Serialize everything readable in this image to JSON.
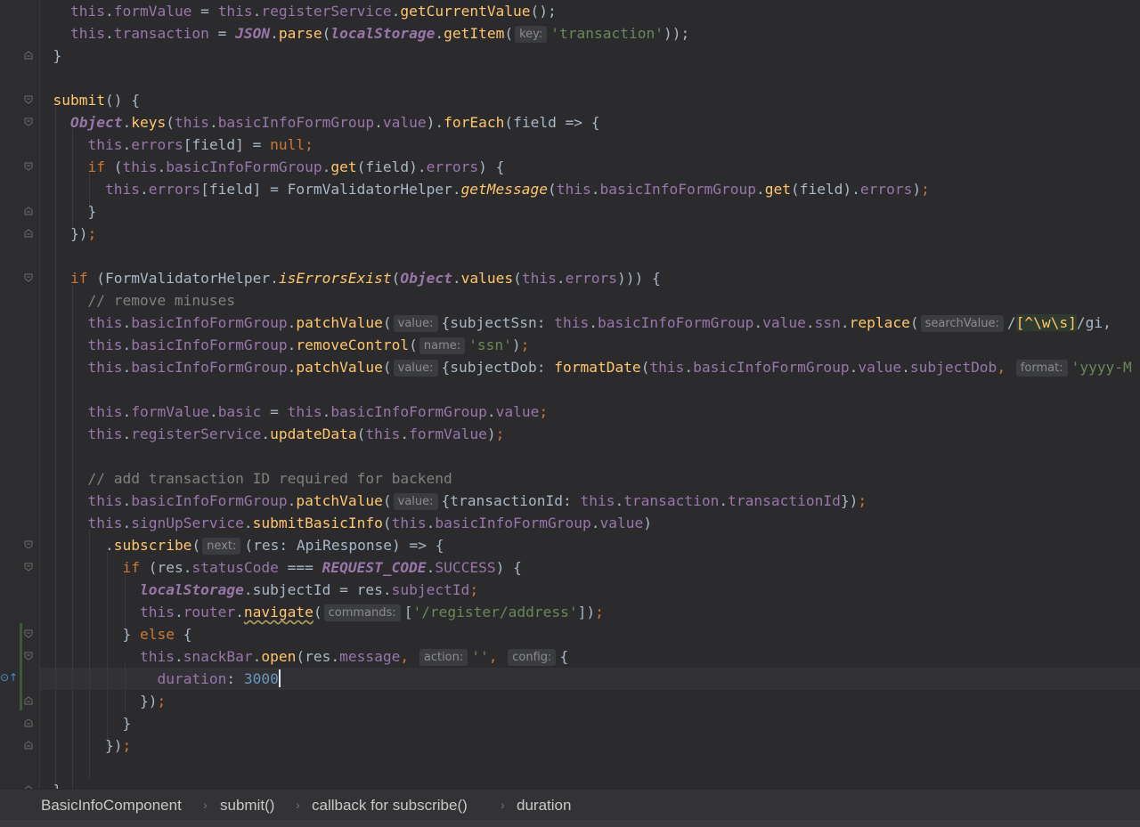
{
  "code_lines": [
    [
      [
        "p",
        "    "
      ],
      [
        "t",
        "this"
      ],
      [
        "p",
        "."
      ],
      [
        "t",
        "formValue"
      ],
      [
        "p",
        " = "
      ],
      [
        "t",
        "this"
      ],
      [
        "p",
        "."
      ],
      [
        "t",
        "registerService"
      ],
      [
        "p",
        "."
      ],
      [
        "f",
        "getCurrentValue"
      ],
      [
        "p",
        "();"
      ]
    ],
    [
      [
        "p",
        "    "
      ],
      [
        "t",
        "this"
      ],
      [
        "p",
        "."
      ],
      [
        "t",
        "transaction"
      ],
      [
        "p",
        " = "
      ],
      [
        "g",
        "JSON"
      ],
      [
        "p",
        "."
      ],
      [
        "f",
        "parse"
      ],
      [
        "p",
        "("
      ],
      [
        "g",
        "localStorage"
      ],
      [
        "p",
        "."
      ],
      [
        "f",
        "getItem"
      ],
      [
        "p",
        "("
      ],
      [
        "hint",
        "key:"
      ],
      [
        "s",
        "'transaction'"
      ],
      [
        "p",
        "));"
      ]
    ],
    [
      [
        "p",
        "  }"
      ]
    ],
    [
      [
        "p",
        ""
      ]
    ],
    [
      [
        "p",
        "  "
      ],
      [
        "f",
        "submit"
      ],
      [
        "p",
        "() {"
      ]
    ],
    [
      [
        "p",
        "    "
      ],
      [
        "g",
        "Object"
      ],
      [
        "p",
        "."
      ],
      [
        "f",
        "keys"
      ],
      [
        "p",
        "("
      ],
      [
        "t",
        "this"
      ],
      [
        "p",
        "."
      ],
      [
        "t",
        "basicInfoFormGroup"
      ],
      [
        "p",
        "."
      ],
      [
        "t",
        "value"
      ],
      [
        "p",
        ")."
      ],
      [
        "f",
        "forEach"
      ],
      [
        "p",
        "(field => {"
      ]
    ],
    [
      [
        "p",
        "      "
      ],
      [
        "t",
        "this"
      ],
      [
        "p",
        "."
      ],
      [
        "t",
        "errors"
      ],
      [
        "p",
        "[field] = "
      ],
      [
        "k",
        "null"
      ],
      [
        "k",
        ";"
      ]
    ],
    [
      [
        "p",
        "      "
      ],
      [
        "k",
        "if "
      ],
      [
        "p",
        "("
      ],
      [
        "t",
        "this"
      ],
      [
        "p",
        "."
      ],
      [
        "t",
        "basicInfoFormGroup"
      ],
      [
        "p",
        "."
      ],
      [
        "f",
        "get"
      ],
      [
        "p",
        "(field)."
      ],
      [
        "t",
        "errors"
      ],
      [
        "p",
        ") {"
      ]
    ],
    [
      [
        "p",
        "        "
      ],
      [
        "t",
        "this"
      ],
      [
        "p",
        "."
      ],
      [
        "t",
        "errors"
      ],
      [
        "p",
        "[field] = FormValidatorHelper."
      ],
      [
        "gi",
        "getMessage"
      ],
      [
        "p",
        "("
      ],
      [
        "t",
        "this"
      ],
      [
        "p",
        "."
      ],
      [
        "t",
        "basicInfoFormGroup"
      ],
      [
        "p",
        "."
      ],
      [
        "f",
        "get"
      ],
      [
        "p",
        "(field)."
      ],
      [
        "t",
        "errors"
      ],
      [
        "p",
        ")"
      ],
      [
        "k",
        ";"
      ]
    ],
    [
      [
        "p",
        "      }"
      ]
    ],
    [
      [
        "p",
        "    })"
      ],
      [
        "k",
        ";"
      ]
    ],
    [
      [
        "p",
        ""
      ]
    ],
    [
      [
        "p",
        "    "
      ],
      [
        "k",
        "if "
      ],
      [
        "p",
        "(FormValidatorHelper."
      ],
      [
        "gi",
        "isErrorsExist"
      ],
      [
        "p",
        "("
      ],
      [
        "g",
        "Object"
      ],
      [
        "p",
        "."
      ],
      [
        "f",
        "values"
      ],
      [
        "p",
        "("
      ],
      [
        "t",
        "this"
      ],
      [
        "p",
        "."
      ],
      [
        "t",
        "errors"
      ],
      [
        "p",
        "))) {"
      ]
    ],
    [
      [
        "c",
        "      // remove minuses"
      ]
    ],
    [
      [
        "p",
        "      "
      ],
      [
        "t",
        "this"
      ],
      [
        "p",
        "."
      ],
      [
        "t",
        "basicInfoFormGroup"
      ],
      [
        "p",
        "."
      ],
      [
        "f",
        "patchValue"
      ],
      [
        "p",
        "("
      ],
      [
        "hint",
        "value:"
      ],
      [
        "p",
        "{subjectSsn: "
      ],
      [
        "t",
        "this"
      ],
      [
        "p",
        "."
      ],
      [
        "t",
        "basicInfoFormGroup"
      ],
      [
        "p",
        "."
      ],
      [
        "t",
        "value"
      ],
      [
        "p",
        "."
      ],
      [
        "t",
        "ssn"
      ],
      [
        "p",
        "."
      ],
      [
        "f",
        "replace"
      ],
      [
        "p",
        "("
      ],
      [
        "hint",
        "searchValue:"
      ],
      [
        "p",
        "/"
      ],
      [
        "rx",
        "[^\\w\\s]"
      ],
      [
        "p",
        "/gi,"
      ]
    ],
    [
      [
        "p",
        "      "
      ],
      [
        "t",
        "this"
      ],
      [
        "p",
        "."
      ],
      [
        "t",
        "basicInfoFormGroup"
      ],
      [
        "p",
        "."
      ],
      [
        "f",
        "removeControl"
      ],
      [
        "p",
        "("
      ],
      [
        "hint",
        "name:"
      ],
      [
        "s",
        "'ssn'"
      ],
      [
        "p",
        ")"
      ],
      [
        "k",
        ";"
      ]
    ],
    [
      [
        "p",
        "      "
      ],
      [
        "t",
        "this"
      ],
      [
        "p",
        "."
      ],
      [
        "t",
        "basicInfoFormGroup"
      ],
      [
        "p",
        "."
      ],
      [
        "f",
        "patchValue"
      ],
      [
        "p",
        "("
      ],
      [
        "hint",
        "value:"
      ],
      [
        "p",
        "{subjectDob: "
      ],
      [
        "f",
        "formatDate"
      ],
      [
        "p",
        "("
      ],
      [
        "t",
        "this"
      ],
      [
        "p",
        "."
      ],
      [
        "t",
        "basicInfoFormGroup"
      ],
      [
        "p",
        "."
      ],
      [
        "t",
        "value"
      ],
      [
        "p",
        "."
      ],
      [
        "t",
        "subjectDob"
      ],
      [
        "k",
        ", "
      ],
      [
        "hint",
        "format:"
      ],
      [
        "s",
        "'yyyy-M"
      ]
    ],
    [
      [
        "p",
        ""
      ]
    ],
    [
      [
        "p",
        "      "
      ],
      [
        "t",
        "this"
      ],
      [
        "p",
        "."
      ],
      [
        "t",
        "formValue"
      ],
      [
        "p",
        "."
      ],
      [
        "t",
        "basic"
      ],
      [
        "p",
        " = "
      ],
      [
        "t",
        "this"
      ],
      [
        "p",
        "."
      ],
      [
        "t",
        "basicInfoFormGroup"
      ],
      [
        "p",
        "."
      ],
      [
        "t",
        "value"
      ],
      [
        "k",
        ";"
      ]
    ],
    [
      [
        "p",
        "      "
      ],
      [
        "t",
        "this"
      ],
      [
        "p",
        "."
      ],
      [
        "t",
        "registerService"
      ],
      [
        "p",
        "."
      ],
      [
        "f",
        "updateData"
      ],
      [
        "p",
        "("
      ],
      [
        "t",
        "this"
      ],
      [
        "p",
        "."
      ],
      [
        "t",
        "formValue"
      ],
      [
        "p",
        ")"
      ],
      [
        "k",
        ";"
      ]
    ],
    [
      [
        "p",
        ""
      ]
    ],
    [
      [
        "c",
        "      // add transaction ID required for backend"
      ]
    ],
    [
      [
        "p",
        "      "
      ],
      [
        "t",
        "this"
      ],
      [
        "p",
        "."
      ],
      [
        "t",
        "basicInfoFormGroup"
      ],
      [
        "p",
        "."
      ],
      [
        "f",
        "patchValue"
      ],
      [
        "p",
        "("
      ],
      [
        "hint",
        "value:"
      ],
      [
        "p",
        "{transactionId: "
      ],
      [
        "t",
        "this"
      ],
      [
        "p",
        "."
      ],
      [
        "t",
        "transaction"
      ],
      [
        "p",
        "."
      ],
      [
        "t",
        "transactionId"
      ],
      [
        "p",
        "})"
      ],
      [
        "k",
        ";"
      ]
    ],
    [
      [
        "p",
        "      "
      ],
      [
        "t",
        "this"
      ],
      [
        "p",
        "."
      ],
      [
        "t",
        "signUpService"
      ],
      [
        "p",
        "."
      ],
      [
        "f",
        "submitBasicInfo"
      ],
      [
        "p",
        "("
      ],
      [
        "t",
        "this"
      ],
      [
        "p",
        "."
      ],
      [
        "t",
        "basicInfoFormGroup"
      ],
      [
        "p",
        "."
      ],
      [
        "t",
        "value"
      ],
      [
        "p",
        ")"
      ]
    ],
    [
      [
        "p",
        "        ."
      ],
      [
        "f",
        "subscribe"
      ],
      [
        "p",
        "("
      ],
      [
        "hint",
        "next:"
      ],
      [
        "p",
        "(res: ApiResponse) => {"
      ]
    ],
    [
      [
        "p",
        "          "
      ],
      [
        "k",
        "if "
      ],
      [
        "p",
        "(res."
      ],
      [
        "t",
        "statusCode"
      ],
      [
        "p",
        " === "
      ],
      [
        "g",
        "REQUEST_CODE"
      ],
      [
        "p",
        "."
      ],
      [
        "t",
        "SUCCESS"
      ],
      [
        "p",
        ") {"
      ]
    ],
    [
      [
        "p",
        "            "
      ],
      [
        "g",
        "localStorage"
      ],
      [
        "p",
        "."
      ],
      [
        "p",
        "subjectId = res."
      ],
      [
        "t",
        "subjectId"
      ],
      [
        "k",
        ";"
      ]
    ],
    [
      [
        "p",
        "            "
      ],
      [
        "t",
        "this"
      ],
      [
        "p",
        "."
      ],
      [
        "t",
        "router"
      ],
      [
        "p",
        "."
      ],
      [
        "fw",
        "navigate"
      ],
      [
        "p",
        "("
      ],
      [
        "hint",
        "commands:"
      ],
      [
        "p",
        "["
      ],
      [
        "s",
        "'/register/address'"
      ],
      [
        "p",
        "])"
      ],
      [
        "k",
        ";"
      ]
    ],
    [
      [
        "p",
        "          } "
      ],
      [
        "k",
        "else "
      ],
      [
        "p",
        "{"
      ]
    ],
    [
      [
        "p",
        "            "
      ],
      [
        "t",
        "this"
      ],
      [
        "p",
        "."
      ],
      [
        "t",
        "snackBar"
      ],
      [
        "p",
        "."
      ],
      [
        "f",
        "open"
      ],
      [
        "p",
        "(res."
      ],
      [
        "t",
        "message"
      ],
      [
        "k",
        ", "
      ],
      [
        "hint",
        "action:"
      ],
      [
        "s",
        "''"
      ],
      [
        "k",
        ", "
      ],
      [
        "hint",
        "config:"
      ],
      [
        "p",
        "{"
      ]
    ],
    [
      [
        "p",
        "              "
      ],
      [
        "t",
        "duration"
      ],
      [
        "p",
        ": "
      ],
      [
        "n",
        "3000"
      ],
      [
        "caret",
        ""
      ]
    ],
    [
      [
        "p",
        "            })"
      ],
      [
        "k",
        ";"
      ]
    ],
    [
      [
        "p",
        "          }"
      ]
    ],
    [
      [
        "p",
        "        })"
      ],
      [
        "k",
        ";"
      ]
    ],
    [
      [
        "p",
        ""
      ]
    ],
    [
      [
        "p",
        "  }"
      ]
    ]
  ],
  "breadcrumb": {
    "items": [
      "BasicInfoComponent",
      "submit()",
      "callback for subscribe()",
      "duration"
    ],
    "separator": "›"
  },
  "colors": {
    "background": "#2b2b2d",
    "keyword": "#cc7832",
    "member": "#9876aa",
    "function": "#ffc66d",
    "string": "#6a8759",
    "number": "#6897bb",
    "comment": "#808080",
    "text": "#a9b7c6"
  }
}
